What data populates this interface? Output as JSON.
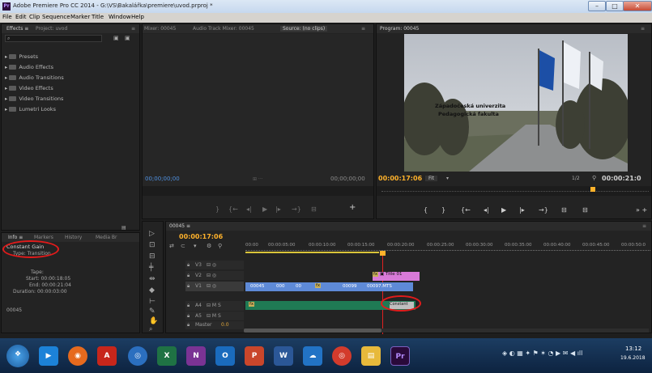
{
  "window": {
    "app_icon": "Pr",
    "title": "Adobe Premiere Pro CC 2014 - G:\\VS\\Bakalářka\\premiere\\uvod.prproj *"
  },
  "menu": [
    "File",
    "Edit",
    "Clip",
    "Sequence",
    "Marker",
    "Title",
    "Window",
    "Help"
  ],
  "effects_panel": {
    "tabs": [
      "Effects ≡",
      "Project: uvod"
    ],
    "items": [
      "Presets",
      "Audio Effects",
      "Audio Transitions",
      "Video Effects",
      "Video Transitions",
      "Lumetri Looks"
    ]
  },
  "source_panel": {
    "tabs": [
      "Mixer: 00045",
      "Audio Track Mixer: 00045",
      "Source: (no clips)"
    ],
    "timecode_left": "00;00;00;00",
    "timecode_right": "00;00;00;00"
  },
  "program_panel": {
    "tab": "Program: 00045",
    "timecode": "00:00:17:06",
    "fit_label": "Fit",
    "quality": "1/2",
    "duration": "00:00:21:0",
    "overlay_line1": "Západočeská univerzita",
    "overlay_line2": "Pedagogická fakulta"
  },
  "info_panel": {
    "tabs": [
      "Info ≡",
      "Markers",
      "History",
      "Media Br"
    ],
    "line1": "Constant Gain",
    "line2": "Type: Transition",
    "tape": "Tape:",
    "start": "Start: 00:00:18:05",
    "end": "End: 00:00:21:04",
    "duration": "Duration: 00:00:03:00",
    "footer": "00045"
  },
  "timeline": {
    "tab": "00045 ≡",
    "timecode": "00:00:17:06",
    "ruler": [
      "00:00",
      "00:00:05:00",
      "00:00:10:00",
      "00:00:15:00",
      "00:00:20:00",
      "00:00:25:00",
      "00:00:30:00",
      "00:00:35:00",
      "00:00:40:00",
      "00:00:45:00",
      "00:00:50:0"
    ],
    "tracks": [
      {
        "name": "V3"
      },
      {
        "name": "V2"
      },
      {
        "name": "V1"
      },
      {
        "name": "A4"
      },
      {
        "name": "A5"
      },
      {
        "name": "Master",
        "value": "0.0"
      }
    ],
    "clips": {
      "title": "Title 01",
      "v1_a": "00045",
      "v1_b": "000",
      "v1_c": "00",
      "v1_d": "00099",
      "v1_e": "00097.MTS",
      "a4_fx": "fx",
      "transition": "Constant"
    }
  },
  "taskbar": {
    "apps": [
      "start",
      "media",
      "firefox",
      "acrobat",
      "chrome",
      "excel",
      "onenote",
      "outlook",
      "powerpoint",
      "word",
      "connect",
      "chrome2",
      "explorer",
      "premiere"
    ],
    "time": "13:12",
    "date": "19.6.2018"
  },
  "colors": {
    "timecode_orange": "#ffb22b",
    "timecode_blue": "#4f90e0",
    "annotation": "#e11b1b",
    "v1_clip": "#5e8ad7",
    "audio_clip": "#1f7a54",
    "title_clip": "#d87ad8"
  }
}
